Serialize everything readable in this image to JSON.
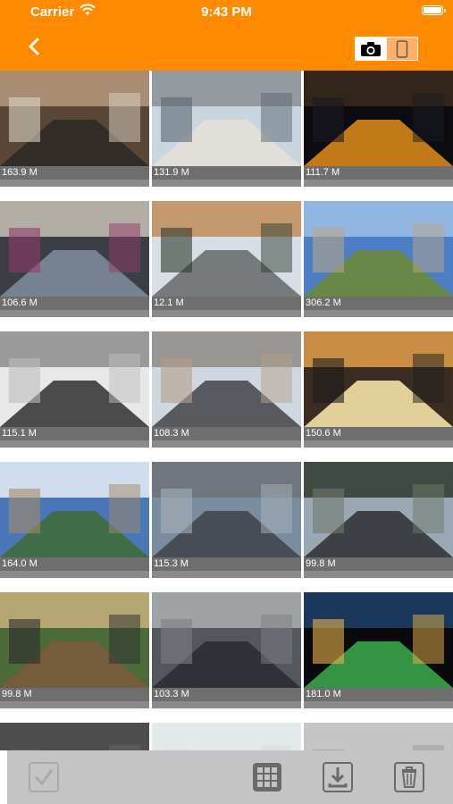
{
  "status_bar": {
    "carrier": "Carrier",
    "time": "9:43 PM"
  },
  "header": {
    "back_icon": "chevron-left-icon",
    "toggle": {
      "photo_icon": "camera-icon",
      "device_icon": "phone-icon",
      "selected": "camera"
    }
  },
  "colors": {
    "accent": "#ff8a00",
    "label_bar": "#6e6e6e",
    "toolbar": "#c4c4c4"
  },
  "photos": [
    {
      "size": "163.9 M",
      "scene": "old town street"
    },
    {
      "size": "131.9 M",
      "scene": "city street with tower"
    },
    {
      "size": "111.7 M",
      "scene": "night light trails"
    },
    {
      "size": "106.6 M",
      "scene": "crosswalk crowd"
    },
    {
      "size": "12.1 M",
      "scene": "european street"
    },
    {
      "size": "306.2 M",
      "scene": "runner on country road"
    },
    {
      "size": "115.1 M",
      "scene": "smiling woman portrait"
    },
    {
      "size": "108.3 M",
      "scene": "downtown avenue"
    },
    {
      "size": "150.6 M",
      "scene": "sunset over city"
    },
    {
      "size": "164.0 M",
      "scene": "coastal cliffs"
    },
    {
      "size": "115.3 M",
      "scene": "aerial city view"
    },
    {
      "size": "99.8 M",
      "scene": "highway through hills"
    },
    {
      "size": "99.8 M",
      "scene": "motorbike in village"
    },
    {
      "size": "103.3 M",
      "scene": "building and parked car"
    },
    {
      "size": "181.0 M",
      "scene": "night highway lights"
    },
    {
      "size": "",
      "scene": "partial row"
    },
    {
      "size": "",
      "scene": "partial row"
    },
    {
      "size": "",
      "scene": "partial row"
    }
  ],
  "toolbar": {
    "select_icon": "checkmark-icon",
    "grid_icon": "grid-icon",
    "download_icon": "download-icon",
    "delete_icon": "trash-icon"
  }
}
